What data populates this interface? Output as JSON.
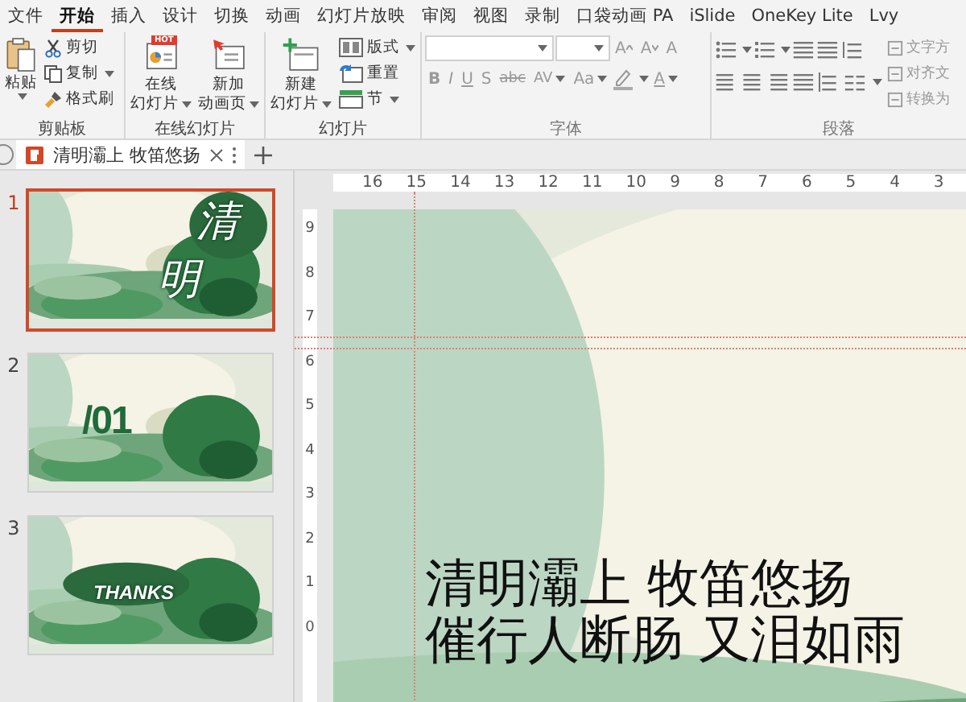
{
  "menu": [
    {
      "label": "文件",
      "selected": false
    },
    {
      "label": "开始",
      "selected": true
    },
    {
      "label": "插入",
      "selected": false
    },
    {
      "label": "设计",
      "selected": false
    },
    {
      "label": "切换",
      "selected": false
    },
    {
      "label": "动画",
      "selected": false
    },
    {
      "label": "幻灯片放映",
      "selected": false
    },
    {
      "label": "审阅",
      "selected": false
    },
    {
      "label": "视图",
      "selected": false
    },
    {
      "label": "录制",
      "selected": false
    },
    {
      "label": "口袋动画 PA",
      "selected": false
    },
    {
      "label": "iSlide",
      "selected": false
    },
    {
      "label": "OneKey Lite",
      "selected": false
    },
    {
      "label": "Lvy",
      "selected": false
    }
  ],
  "clipboard": {
    "label": "剪贴板",
    "paste": "粘贴",
    "cut": "剪切",
    "copy": "复制",
    "painter": "格式刷"
  },
  "online": {
    "label": "在线幻灯片",
    "hot": "HOT",
    "buttons": [
      {
        "kind": "online",
        "lines": [
          "在线",
          "幻灯片"
        ]
      },
      {
        "kind": "animation",
        "lines": [
          "新加",
          "动画页"
        ]
      }
    ]
  },
  "slides_group": {
    "label": "幻灯片",
    "new_slide": [
      "新建",
      "幻灯片"
    ],
    "items": [
      {
        "kind": "layout",
        "label": "版式"
      },
      {
        "kind": "reset",
        "label": "重置"
      },
      {
        "kind": "section",
        "label": "节"
      }
    ]
  },
  "font": {
    "label": "字体",
    "disabled": true,
    "size_buttons": [
      "A",
      "A"
    ],
    "clear": "A",
    "styles": [
      "B",
      "I",
      "U",
      "S",
      "abc"
    ],
    "spacing": "AV",
    "case": "Aa",
    "color_letter": "A"
  },
  "paragraph": {
    "label": "段落",
    "disabled": true,
    "side": [
      "文字方",
      "对齐文",
      "转换为"
    ]
  },
  "doc_tab": {
    "title": "清明灞上 牧笛悠扬"
  },
  "thumbnails": [
    {
      "number": "1",
      "selected": true,
      "kind": "title",
      "glyphs": [
        "清",
        "明"
      ]
    },
    {
      "number": "2",
      "selected": false,
      "kind": "section",
      "text": "/01"
    },
    {
      "number": "3",
      "selected": false,
      "kind": "end",
      "text": "THANKS"
    }
  ],
  "h_ruler": [
    "16",
    "15",
    "14",
    "13",
    "12",
    "11",
    "10",
    "9",
    "8",
    "7",
    "6",
    "5",
    "4",
    "3"
  ],
  "v_ruler": [
    "9",
    "8",
    "7",
    "6",
    "5",
    "4",
    "3",
    "2",
    "1",
    "0"
  ],
  "slide": {
    "lines": [
      "清明灞上 牧笛悠扬",
      "催行人断肠 又泪如雨"
    ]
  }
}
